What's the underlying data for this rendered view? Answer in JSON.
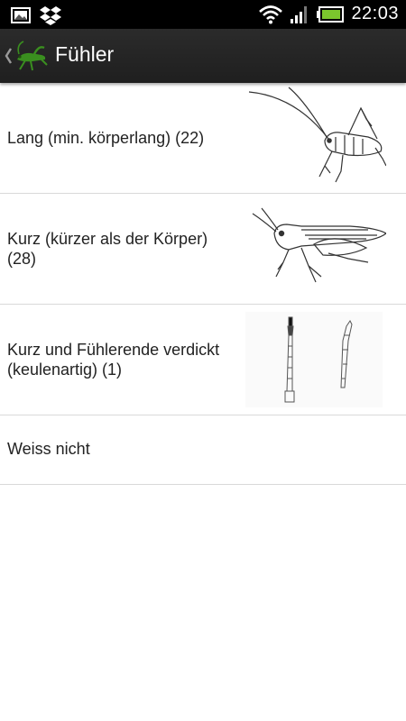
{
  "status_bar": {
    "time": "22:03",
    "icons": [
      "gallery-icon",
      "dropbox-icon",
      "wifi-icon",
      "signal-icon",
      "battery-icon"
    ]
  },
  "action_bar": {
    "title": "Fühler",
    "icons": [
      "back-chevron-icon",
      "grasshopper-app-icon"
    ]
  },
  "list": {
    "items": [
      {
        "label": "Lang (min. körperlang) (22)",
        "image": "bush-cricket-long-antennae-illustration"
      },
      {
        "label": "Kurz (kürzer als der Körper) (28)",
        "image": "grasshopper-short-antennae-illustration"
      },
      {
        "label": "Kurz und Fühlerende verdickt (keulenartig) (1)",
        "image": "club-shaped-antennae-illustration"
      },
      {
        "label": "Weiss nicht"
      }
    ]
  },
  "colors": {
    "status_bar": "#000000",
    "action_bar": "#242424",
    "background": "#ffffff",
    "divider": "#d9d9d9",
    "text": "#222222",
    "battery": "#7bc62d",
    "app_icon_green": "#3a8f1f"
  }
}
